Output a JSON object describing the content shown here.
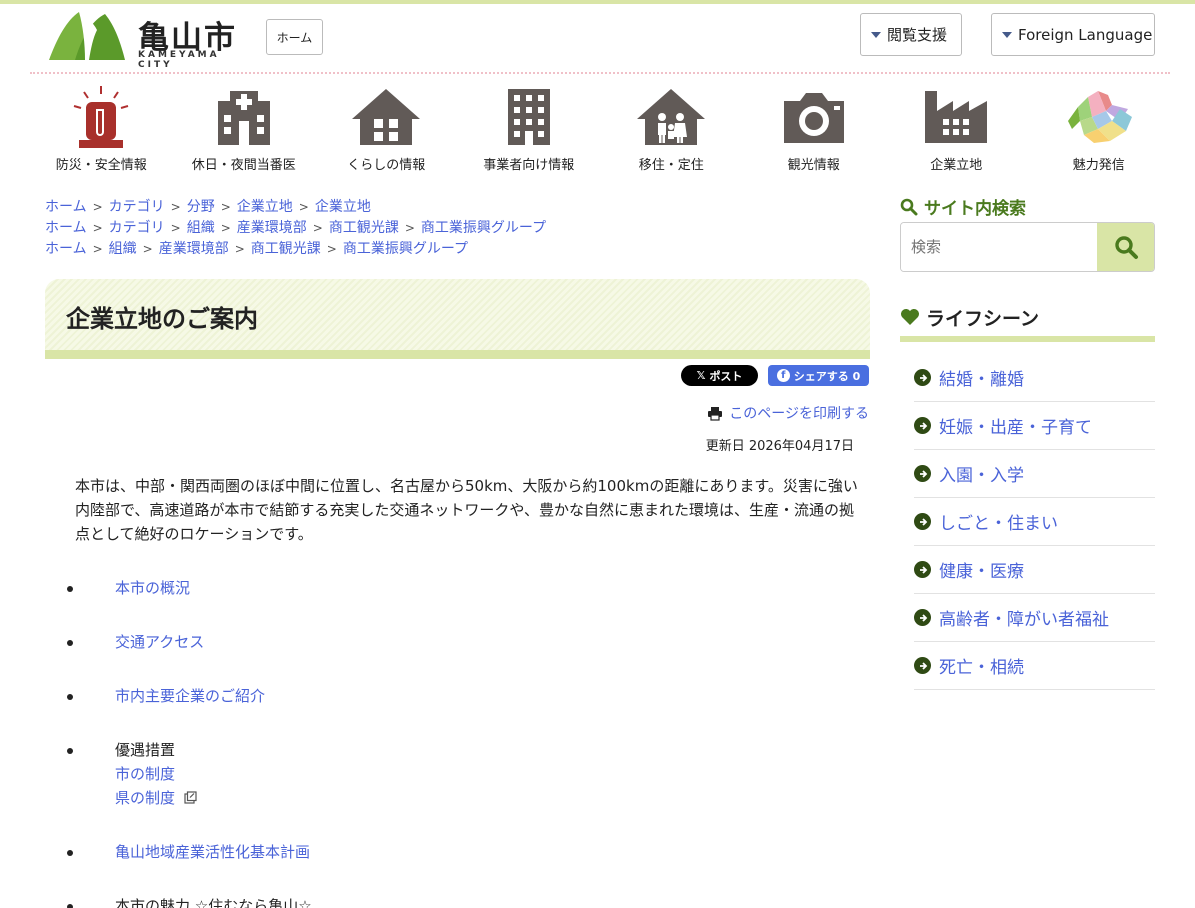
{
  "header": {
    "logo_title": "亀山市",
    "logo_sub": "KAMEYAMA CITY",
    "home_label": "ホーム",
    "reading_support": "閲覧支援",
    "foreign_language": "Foreign Language"
  },
  "nav": [
    {
      "label": "防災・安全情報",
      "icon": "siren-icon"
    },
    {
      "label": "休日・夜間当番医",
      "icon": "hospital-icon"
    },
    {
      "label": "くらしの情報",
      "icon": "house-icon"
    },
    {
      "label": "事業者向け情報",
      "icon": "office-building-icon"
    },
    {
      "label": "移住・定住",
      "icon": "family-house-icon"
    },
    {
      "label": "観光情報",
      "icon": "camera-icon"
    },
    {
      "label": "企業立地",
      "icon": "factory-icon"
    },
    {
      "label": "魅力発信",
      "icon": "map-icon"
    }
  ],
  "breadcrumbs": [
    [
      "ホーム",
      "カテゴリ",
      "分野",
      "企業立地",
      "企業立地"
    ],
    [
      "ホーム",
      "カテゴリ",
      "組織",
      "産業環境部",
      "商工観光課",
      "商工業振興グループ"
    ],
    [
      "ホーム",
      "組織",
      "産業環境部",
      "商工観光課",
      "商工業振興グループ"
    ]
  ],
  "page": {
    "title": "企業立地のご案内",
    "x_post": "ポスト",
    "fb_share": "シェアする 0",
    "print_label": "このページを印刷する",
    "updated": "更新日 2026年04月17日",
    "intro": "本市は、中部・関西両圏のほぼ中間に位置し、名古屋から50km、大阪から約100kmの距離にあります。災害に強い内陸部で、高速道路が本市で結節する充実した交通ネットワークや、豊かな自然に恵まれた環境は、生産・流通の拠点として絶好のロケーションです。"
  },
  "links": {
    "overview": "本市の概況",
    "access": "交通アクセス",
    "companies": "市内主要企業のご紹介",
    "incentives": "優遇措置",
    "city_system": "市の制度",
    "pref_system": "県の制度",
    "basic_plan": "亀山地域産業活性化基本計画",
    "charm": "本市の魅力 ☆住むなら亀山☆"
  },
  "sidebar": {
    "search_heading": "サイト内検索",
    "search_placeholder": "検索",
    "life_heading": "ライフシーン",
    "life_items": [
      "結婚・離婚",
      "妊娠・出産・子育て",
      "入園・入学",
      "しごと・住まい",
      "健康・医療",
      "高齢者・障がい者福祉",
      "死亡・相続"
    ]
  },
  "colors": {
    "accent": "#d9e5a6",
    "link": "#4a63d8",
    "icon_gray": "#615a57",
    "heading_green": "#4a7a1e"
  }
}
